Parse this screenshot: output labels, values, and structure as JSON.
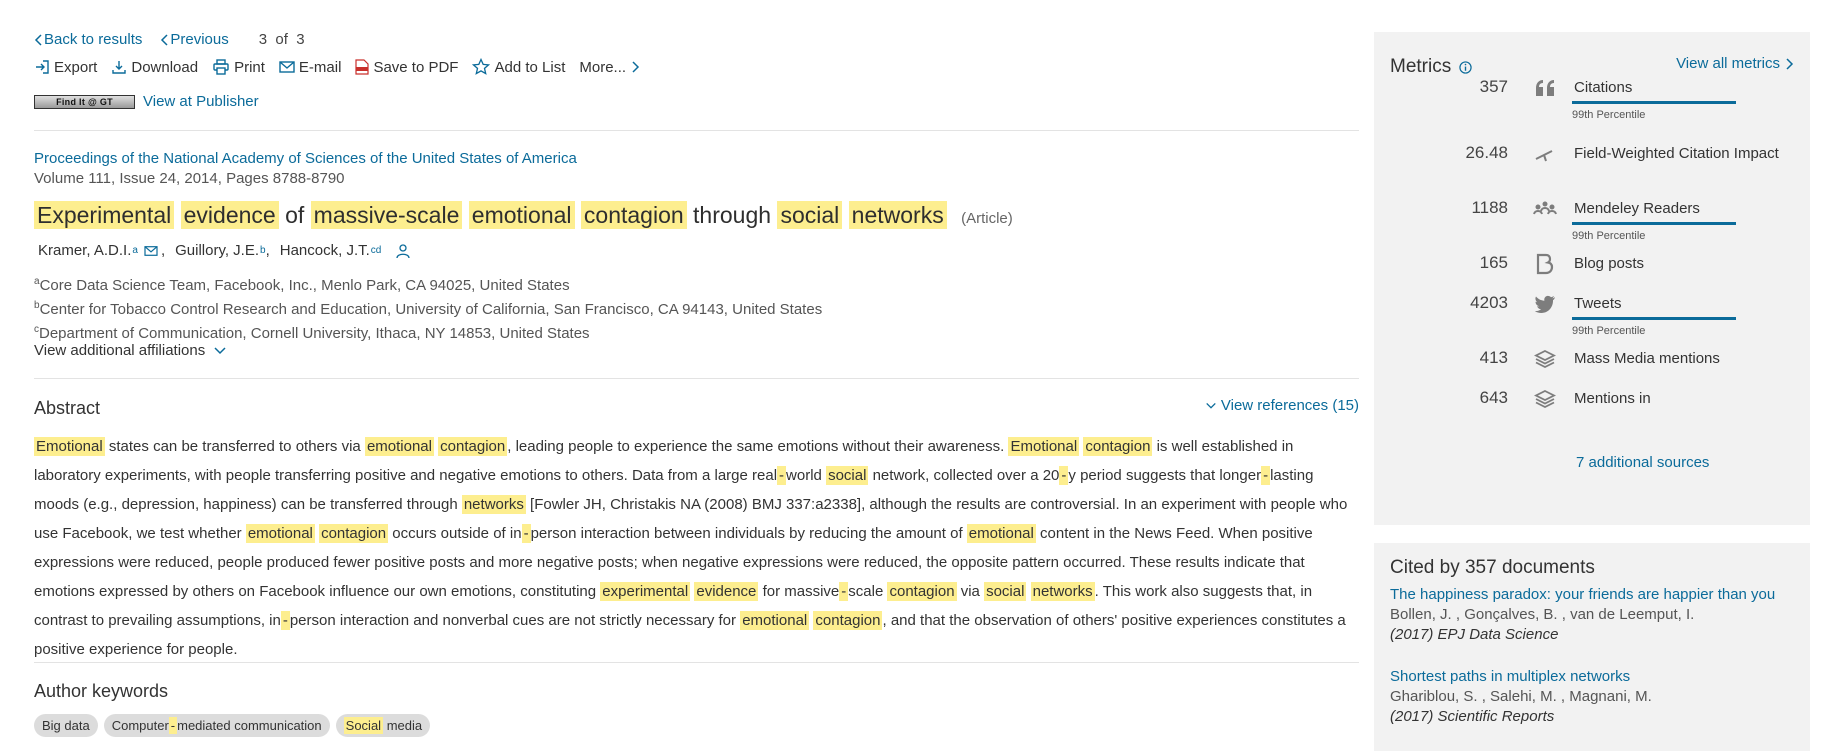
{
  "nav": {
    "back": "Back to results",
    "previous": "Previous",
    "position": "3",
    "of": "of",
    "total": "3"
  },
  "toolbar": {
    "export": "Export",
    "download": "Download",
    "print": "Print",
    "email": "E-mail",
    "save_pdf": "Save to PDF",
    "add_list": "Add to List",
    "more": "More..."
  },
  "findit": {
    "badge": "Find It @ GT",
    "publisher_link": "View at Publisher"
  },
  "document": {
    "source_title": "Proceedings of the National Academy of Sciences of the United States of America",
    "source_meta": "Volume 111, Issue 24, 2014, Pages 8788-8790",
    "title_parts": [
      "Experimental",
      "evidence",
      "of",
      "massive-scale",
      "emotional",
      "contagion",
      "through",
      "social",
      "networks"
    ],
    "type": "(Article)"
  },
  "authors": [
    {
      "name": "Kramer, A.D.I.",
      "sup": "a"
    },
    {
      "name": "Guillory, J.E.",
      "sup": "b"
    },
    {
      "name": "Hancock, J.T.",
      "sup": "cd"
    }
  ],
  "affiliations": [
    {
      "sup": "a",
      "text": "Core Data Science Team, Facebook, Inc., Menlo Park, CA 94025, United States"
    },
    {
      "sup": "b",
      "text": "Center for Tobacco Control Research and Education, University of California, San Francisco, CA 94143, United States"
    },
    {
      "sup": "c",
      "text": "Department of Communication, Cornell University, Ithaca, NY 14853, United States"
    }
  ],
  "view_affiliations": "View additional affiliations",
  "abstract": {
    "heading": "Abstract",
    "view_refs": "View references (15)",
    "text": "Emotional states can be transferred to others via emotional contagion, leading people to experience the same emotions without their awareness. Emotional contagion is well established in laboratory experiments, with people transferring positive and negative emotions to others. Data from a large real-world social network, collected over a 20-y period suggests that longer-lasting moods (e.g., depression, happiness) can be transferred through networks [Fowler JH, Christakis NA (2008) BMJ 337:a2338], although the results are controversial. In an experiment with people who use Facebook, we test whether emotional contagion occurs outside of in-person interaction between individuals by reducing the amount of emotional content in the News Feed. When positive expressions were reduced, people produced fewer positive posts and more negative posts; when negative expressions were reduced, the opposite pattern occurred. These results indicate that emotions expressed by others on Facebook influence our own emotions, constituting experimental evidence for massive-scale contagion via social networks. This work also suggests that, in contrast to prevailing assumptions, in-person interaction and nonverbal cues are not strictly necessary for emotional contagion, and that the observation of others' positive experiences constitutes a positive experience for people.",
    "highlight_words": [
      "Emotional",
      "emotional",
      "contagion",
      "social",
      "networks",
      "experimental",
      "evidence",
      "massive-scale",
      "-"
    ]
  },
  "keywords": {
    "heading": "Author keywords",
    "items": [
      "Big data",
      "Computer-mediated communication",
      "Social media"
    ]
  },
  "metrics": {
    "title": "Metrics",
    "view_all": "View all metrics",
    "items": [
      {
        "value": "357",
        "label": "Citations",
        "icon": "quote-icon",
        "percentile": "99th Percentile",
        "bar": 0.99
      },
      {
        "value": "26.48",
        "label": "Field-Weighted Citation Impact",
        "icon": "scale-icon"
      },
      {
        "value": "1188",
        "label": "Mendeley Readers",
        "icon": "readers-icon",
        "percentile": "99th Percentile",
        "bar": 0.99
      },
      {
        "value": "165",
        "label": "Blog posts",
        "icon": "blog-icon"
      },
      {
        "value": "4203",
        "label": "Tweets",
        "icon": "twitter-icon",
        "percentile": "99th Percentile",
        "bar": 0.99
      },
      {
        "value": "413",
        "label": "Mass Media mentions",
        "icon": "layers-icon"
      },
      {
        "value": "643",
        "label": "Mentions in",
        "icon": "layers-icon"
      }
    ],
    "sources_link": "7 additional sources"
  },
  "cited_by": {
    "heading": "Cited by 357 documents",
    "items": [
      {
        "title": "The happiness paradox: your friends are happier than you",
        "authors": "Bollen, J. , Gonçalves, B. , van de Leemput, I.",
        "journal": "(2017) EPJ Data Science"
      },
      {
        "title": "Shortest paths in multiplex networks",
        "authors": "Ghariblou, S. , Salehi, M. , Magnani, M.",
        "journal": "(2017) Scientific Reports"
      }
    ]
  },
  "colors": {
    "link": "#0b6b9a",
    "highlight": "#fdee8f",
    "panel_bg": "#f2f2f2"
  }
}
